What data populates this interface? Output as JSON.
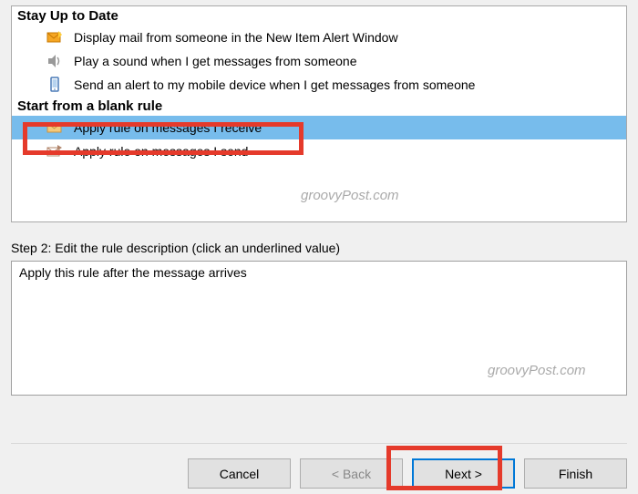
{
  "sections": {
    "stay_up": {
      "header": "Stay Up to Date",
      "items": [
        {
          "label": "Display mail from someone in the New Item Alert Window"
        },
        {
          "label": "Play a sound when I get messages from someone"
        },
        {
          "label": "Send an alert to my mobile device when I get messages from someone"
        }
      ]
    },
    "blank": {
      "header": "Start from a blank rule",
      "items": [
        {
          "label": "Apply rule on messages I receive",
          "selected": true
        },
        {
          "label": "Apply rule on messages I send"
        }
      ]
    }
  },
  "step2": {
    "label": "Step 2: Edit the rule description (click an underlined value)",
    "description": "Apply this rule after the message arrives"
  },
  "buttons": {
    "cancel": "Cancel",
    "back": "< Back",
    "next": "Next >",
    "finish": "Finish"
  },
  "watermark": "groovyPost.com"
}
